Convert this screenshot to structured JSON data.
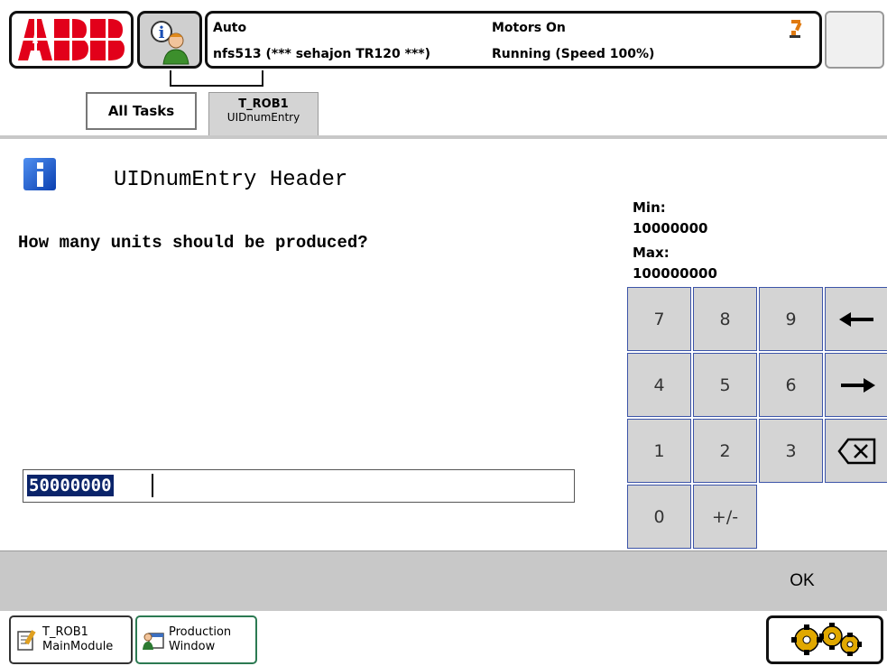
{
  "header": {
    "mode": "Auto",
    "motors": "Motors On",
    "program": "nfs513 (*** sehajon TR120 ***)",
    "running": "Running (Speed 100%)"
  },
  "tabs": {
    "all_tasks": "All Tasks",
    "task_name": "T_ROB1",
    "task_sub": "UIDnumEntry"
  },
  "dialog": {
    "title": "UIDnumEntry Header",
    "question": "How many units should be produced?",
    "min_label": "Min:",
    "min_value": "10000000",
    "max_label": "Max:",
    "max_value": "100000000",
    "input_value": "50000000"
  },
  "keypad": {
    "k7": "7",
    "k8": "8",
    "k9": "9",
    "k4": "4",
    "k5": "5",
    "k6": "6",
    "k1": "1",
    "k2": "2",
    "k3": "3",
    "k0": "0",
    "sign": "+/-"
  },
  "actions": {
    "ok": "OK"
  },
  "taskbar": {
    "item1_line1": "T_ROB1",
    "item1_line2": "MainModule",
    "item2_line1": "Production",
    "item2_line2": "Window"
  },
  "icons": {
    "logo": "abb-logo",
    "info": "info-user-icon",
    "dialog_info": "info-icon",
    "close": "close-icon",
    "left_arrow": "arrow-left-icon",
    "right_arrow": "arrow-right-icon",
    "backspace": "backspace-icon",
    "quickset": "gears-icon"
  },
  "colors": {
    "abb_red": "#e2001a",
    "keypad_gray": "#d4d4d4",
    "keypad_border": "#3c54a8",
    "selection": "#0a246a",
    "action_bar": "#c8c8c8"
  }
}
